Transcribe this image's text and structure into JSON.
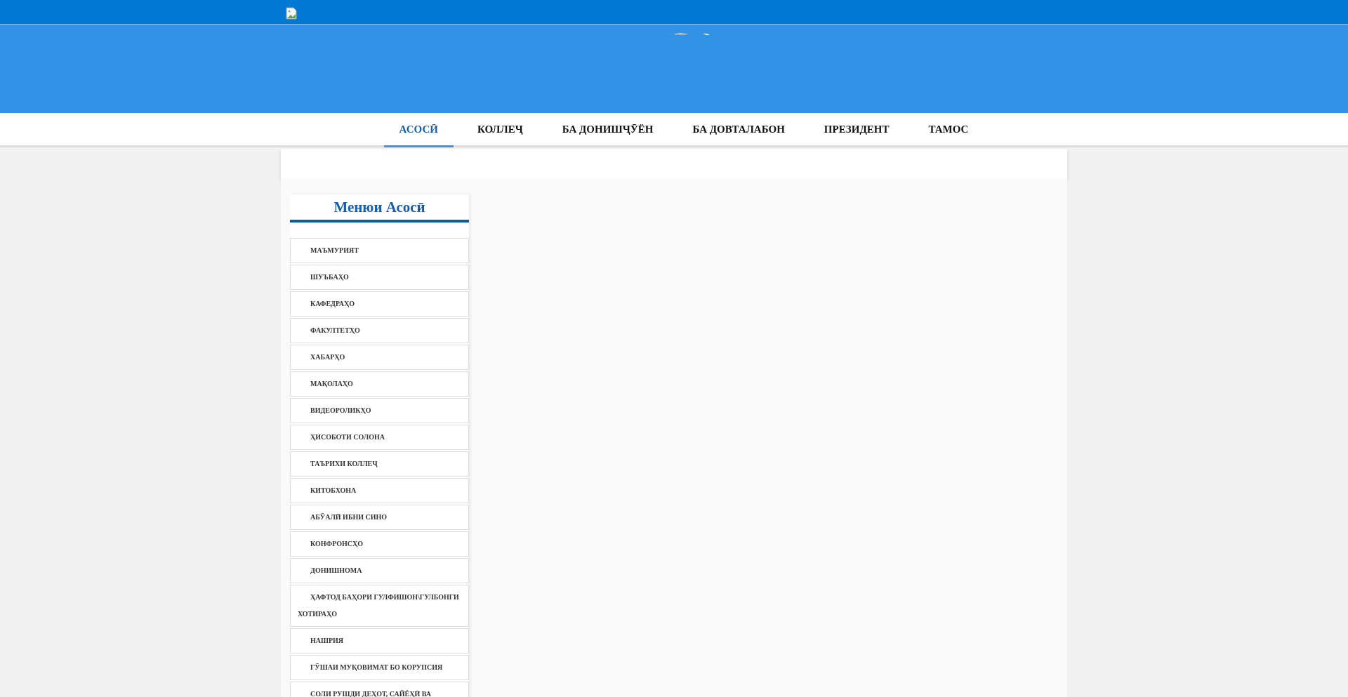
{
  "nav": [
    {
      "label": "АСОСӢ",
      "selected": true
    },
    {
      "label": "КОЛЛЕҶ",
      "selected": false
    },
    {
      "label": "БА ДОНИШҶӮЁН",
      "selected": false
    },
    {
      "label": "БА ДОВТАЛАБОН",
      "selected": false
    },
    {
      "label": "ПРЕЗИДЕНТ",
      "selected": false
    },
    {
      "label": "ТАМОС",
      "selected": false
    }
  ],
  "sidebar": {
    "title": "Менюи Асосӣ",
    "items": [
      "МАЪМУРИЯТ",
      "ШУЪБАҲО",
      "КАФЕДРАҲО",
      "ФАКУЛТЕТҲО",
      "ХАБАРҲО",
      "МАҚОЛАҲО",
      "ВИДЕОРОЛИКҲО",
      "ҲИСОБОТИ СОЛОНА",
      "ТАЪРИХИ КОЛЛЕҶ",
      "КИТОБХОНА",
      "АБӮАЛӢ ИБНИ СИНО",
      "КОНФРОНСҲО",
      "ДОНИШНОМА",
      "ҲАФТОД БАҲОРИ ГУЛФИШОН\\ГУЛБОНГИ ХОТИРАҲО",
      "НАШРИЯ",
      "ГӮШАИ МУҚОВИМАТ БО КОРУПСИЯ",
      "СОЛИ РУШДИ ДЕҲОТ, САЙЁҲӢ ВА"
    ]
  }
}
